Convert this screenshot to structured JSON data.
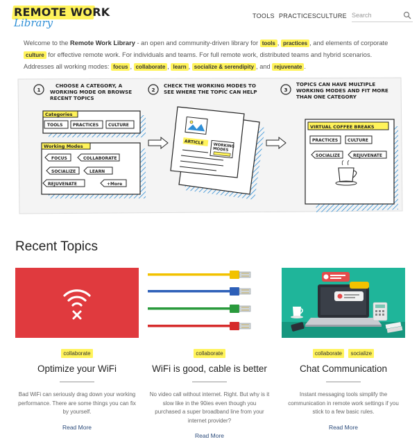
{
  "header": {
    "logo_top": "REMOTE WORK",
    "logo_bottom": "Library",
    "nav": [
      "TOOLS",
      "PRACTICES",
      "CULTURE"
    ],
    "search_placeholder": "Search"
  },
  "intro": {
    "p1_before": "Welcome to the ",
    "p1_brand": "Remote Work Library",
    "p1_mid": " - an open and community-driven library for ",
    "tag_tools": "tools",
    "sep1": ", ",
    "tag_practices": "practices",
    "p1_after": ", and elements of corporate",
    "tag_culture": "culture",
    "p1_end": " for effective remote work. For individuals and teams. For full remote work, distributed teams and hybrid scenarios.",
    "p2_start": "Addresses all working modes: ",
    "mode_focus": "focus",
    "mode_collaborate": "collaborate",
    "mode_learn": "learn",
    "mode_socialize": "socialize & serendipity",
    "and_word": ", and ",
    "mode_rejuvenate": "rejuvenate",
    "period": "."
  },
  "illustration": {
    "step1_num": "1",
    "step1_text": [
      "CHOOSE A CATEGORY, A",
      "WORKING MODE OR BROWSE",
      "RECENT TOPICS"
    ],
    "step2_num": "2",
    "step2_text": [
      "CHECK THE WORKING MODES TO",
      "SEE WHERE THE TOPIC CAN HELP"
    ],
    "step3_num": "3",
    "step3_text": [
      "TOPICS CAN HAVE MULTIPLE",
      "WORKING MODES AND FIT MORE",
      "THAN ONE CATEGORY"
    ],
    "categories_label": "Categories",
    "cat_tools": "TOOLS",
    "cat_practices": "PRACTICES",
    "cat_culture": "CULTURE",
    "modes_label": "Working Modes",
    "mode_focus": "FOCUS",
    "mode_collaborate": "COLLABORATE",
    "mode_socialize": "SOCIALIZE",
    "mode_learn": "LEARN",
    "mode_rejuvenate": "REJUVENATE",
    "mode_more": "+More",
    "article_label": "ARTICLE",
    "article_modes": [
      "WORKING",
      "MODES"
    ],
    "vcb_title": "VIRTUAL COFFEE BREAKS",
    "vcb_practices": "PRACTICES",
    "vcb_culture": "CULTURE",
    "vcb_socialize": "SOCIALIZE",
    "vcb_rejuvenate": "REJUVENATE"
  },
  "recent": {
    "title": "Recent Topics",
    "cards": [
      {
        "tags": [
          "collaborate"
        ],
        "title": "Optimize your WiFi",
        "desc": "Bad WiFi can seriously drag down your working performance. There are some things you can fix by yourself.",
        "more": "Read More"
      },
      {
        "tags": [
          "collaborate"
        ],
        "title": "WiFi is good, cable is better",
        "desc": "No video call without internet. Right. But why is it slow like in the 90ies even though you purchased a super broadband line from your internet provider?",
        "more": "Read More"
      },
      {
        "tags": [
          "collaborate",
          "socialize"
        ],
        "title": "Chat Communication",
        "desc": "Instant messaging tools simplify the communication in remote work settings if you stick to a few basic rules.",
        "more": "Read More"
      }
    ]
  },
  "colors": {
    "highlight": "#fff35a",
    "wifi_red": "#e03a3e",
    "chat_teal": "#1fb59a",
    "link": "#2a4a7a",
    "logo_blue": "#2f8fd6"
  }
}
